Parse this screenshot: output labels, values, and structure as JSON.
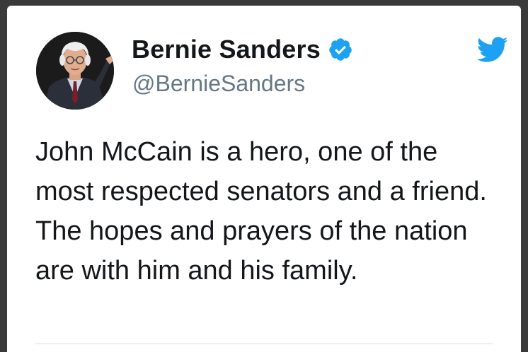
{
  "tweet": {
    "display_name": "Bernie Sanders",
    "handle": "@BernieSanders",
    "verified": true,
    "text": "John McCain is a hero, one of the most respected senators and a friend. The hopes and prayers of the nation are with him and his family."
  },
  "icons": {
    "verified": "verified-badge-icon",
    "brand": "twitter-bird-icon"
  },
  "colors": {
    "brand_blue": "#1DA1F2",
    "text_primary": "#14171A",
    "text_secondary": "#657786"
  }
}
